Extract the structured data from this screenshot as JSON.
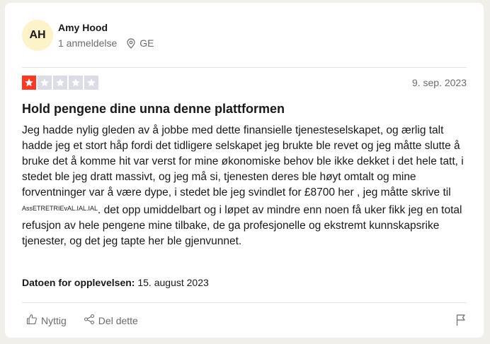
{
  "reviewer": {
    "initials": "AH",
    "name": "Amy Hood",
    "review_count": "1 anmeldelse",
    "country": "GE"
  },
  "review": {
    "rating": 1,
    "max_rating": 5,
    "date": "9. sep. 2023",
    "title": "Hold pengene dine unna denne plattformen",
    "body_part1": "Jeg hadde nylig gleden av å jobbe med dette finansielle tjenesteselskapet, og ærlig talt hadde jeg et stort håp fordi det tidligere selskapet jeg brukte ble revet og jeg måtte slutte å bruke det å komme hit var verst for mine økonomiske behov ble ikke dekket i det hele tatt, i stedet ble jeg dratt massivt, og jeg må si, tjenesten deres ble høyt omtalt og mine forventninger var å være dype, i stedet ble jeg svindlet for £8700 her , jeg måtte skrive til ",
    "body_small": "AssETRETRIEvAL.IAL.IAL",
    "body_part2": ". det opp umiddelbart og i løpet av mindre enn noen få uker fikk jeg en total refusjon av hele pengene mine tilbake, de ga profesjonelle og ekstremt kunnskapsrike tjenester, og det jeg tapte her ble gjenvunnet.",
    "experience_label": "Datoen for opplevelsen:",
    "experience_date": "15. august 2023"
  },
  "actions": {
    "useful_label": "Nyttig",
    "share_label": "Del dette"
  },
  "icons": {
    "location": "location-pin-icon",
    "star": "star-icon",
    "thumbs_up": "thumbs-up-icon",
    "share": "share-icon",
    "flag": "flag-icon"
  },
  "colors": {
    "star_filled": "#ff3722",
    "star_empty": "#dcdce6",
    "avatar_bg": "#fdf3c8",
    "page_bg": "#f0efea"
  }
}
